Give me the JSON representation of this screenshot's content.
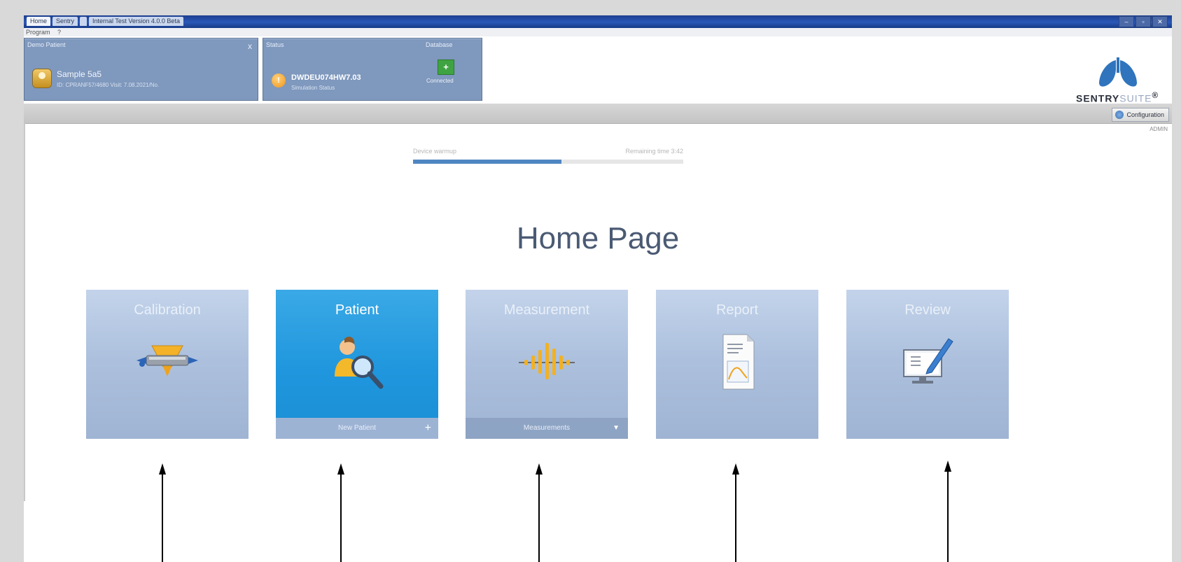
{
  "window": {
    "tabs": [
      "Home",
      "Sentry",
      "",
      "Internal Test Version 4.0.0 Beta"
    ],
    "controls": [
      "–",
      "▫",
      "✕"
    ],
    "menu": [
      "Program",
      "?"
    ]
  },
  "patient_panel": {
    "title": "Demo Patient",
    "name": "Sample 5a5",
    "sub": "ID: CPRANF57/4680 Visit: 7.08.2021/No.",
    "close": "x"
  },
  "status_panel": {
    "title": "Status",
    "main": "DWDEU074HW7.03",
    "sub": "Simulation Status",
    "icon": "!"
  },
  "database_panel": {
    "title": "Database",
    "label": "Connected",
    "icon": "+"
  },
  "logo": {
    "brand": "SENTRY",
    "suite": "SUITE",
    "mark": "®"
  },
  "toolbar": {
    "config_label": "Configuration",
    "user_label": "ADMIN"
  },
  "progress": {
    "left_label": "Device warmup",
    "right_label": "Remaining time 3:42",
    "fraction": 0.55
  },
  "page_title": "Home Page",
  "tiles": [
    {
      "label": "Calibration",
      "footer": "",
      "icon": "calibration-icon",
      "active": false
    },
    {
      "label": "Patient",
      "footer": "New Patient",
      "footer_icon": "+",
      "icon": "patient-search-icon",
      "active": true
    },
    {
      "label": "Measurement",
      "footer": "Measurements",
      "footer_icon": "▼",
      "icon": "measurement-icon",
      "active": false
    },
    {
      "label": "Report",
      "footer": "",
      "icon": "report-icon",
      "active": false
    },
    {
      "label": "Review",
      "footer": "",
      "icon": "review-icon",
      "active": false
    }
  ],
  "colors": {
    "tile": "#adc1de",
    "tile_active": "#1f96dd",
    "title": "#4a5a73",
    "progress": "#4f86c2",
    "panel": "#7f98bd"
  }
}
